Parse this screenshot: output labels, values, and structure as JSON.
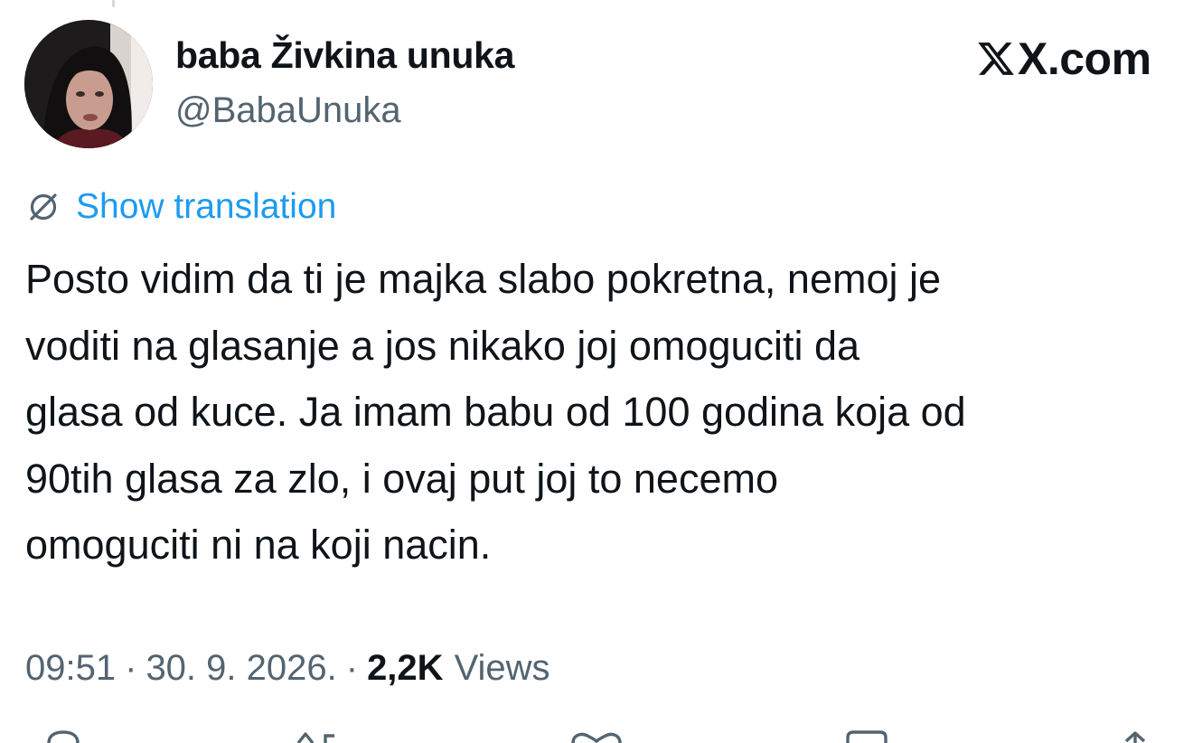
{
  "author": {
    "display_name": "baba Živkina unuka",
    "handle": "@BabaUnuka"
  },
  "brand": {
    "text": "X.com",
    "icon": "x-logo-icon"
  },
  "translation": {
    "icon": "globe-slash-icon",
    "label": "Show translation",
    "color": "#1d9bf0"
  },
  "tweet": {
    "lines": [
      "Posto vidim da ti je majka slabo pokretna, nemoj je",
      "voditi na glasanje a jos nikako joj omoguciti da",
      "glasa od kuce. Ja imam babu od 100 godina koja od",
      "90tih glasa za zlo, i ovaj put joj to necemo",
      "omoguciti ni na koji nacin."
    ]
  },
  "meta": {
    "time": "09:51",
    "separator": "·",
    "date": "30. 9. 2026.",
    "views_count": "2,2K",
    "views_label": "Views"
  },
  "actions": [
    {
      "name": "reply-icon"
    },
    {
      "name": "repost-icon"
    },
    {
      "name": "like-icon"
    },
    {
      "name": "bookmark-icon"
    },
    {
      "name": "share-icon"
    }
  ],
  "colors": {
    "text_primary": "#0f1419",
    "text_secondary": "#536471",
    "accent": "#1d9bf0"
  }
}
